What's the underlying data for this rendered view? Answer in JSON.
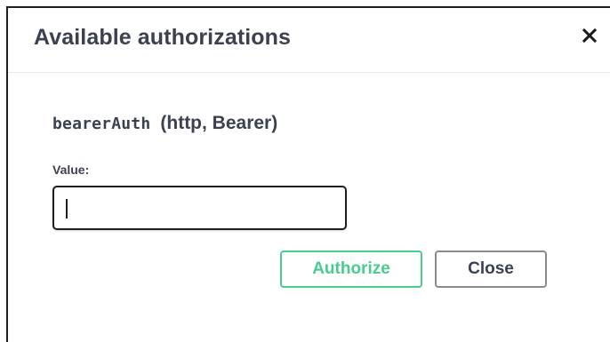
{
  "modal": {
    "title": "Available authorizations",
    "close_icon": "close-x-icon"
  },
  "scheme": {
    "name": "bearerAuth",
    "type": "(http, Bearer)"
  },
  "value_field": {
    "label": "Value:",
    "value": ""
  },
  "buttons": {
    "authorize_label": "Authorize",
    "close_label": "Close"
  },
  "colors": {
    "authorize_accent": "#49cc90",
    "text": "#3b4151",
    "border_dark": "#1e1e1e",
    "close_border": "#8a8a8a"
  }
}
